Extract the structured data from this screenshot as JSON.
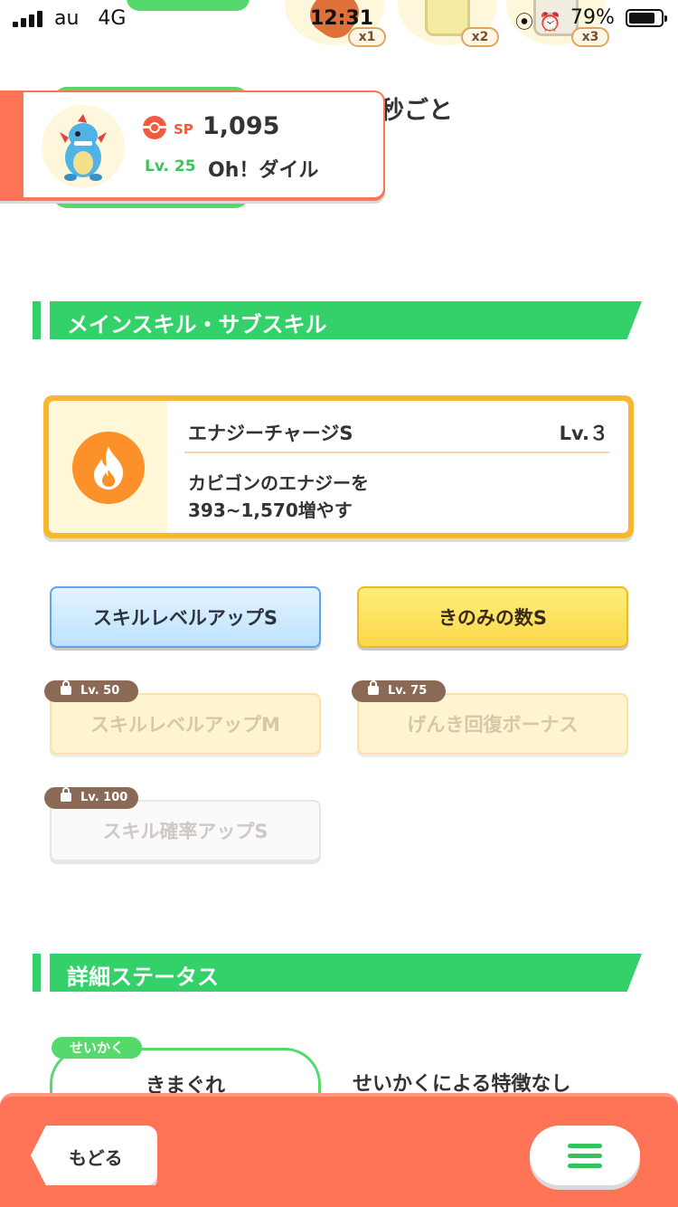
{
  "status_bar": {
    "carrier": "au",
    "network": "4G",
    "time": "12:31",
    "battery": "79%"
  },
  "top_items": [
    {
      "mult": "x1"
    },
    {
      "mult": "x2"
    },
    {
      "mult": "x3"
    }
  ],
  "background_fragment": "秒ごと",
  "pokemon": {
    "sp_label": "SP",
    "sp_value": "1,095",
    "level": "Lv. 25",
    "name": "Oh！ダイル"
  },
  "section_skills": {
    "title": "メインスキル・サブスキル"
  },
  "main_skill": {
    "name": "エナジーチャージS",
    "level": "Lv.３",
    "desc_line1": "カビゴンのエナジーを",
    "desc_line2": "393~1,570増やす",
    "icon": "flame-icon"
  },
  "sub_skills": [
    {
      "label": "スキルレベルアップS"
    },
    {
      "label": "きのみの数S"
    },
    {
      "label": "スキルレベルアップM",
      "lock": "Lv. 50"
    },
    {
      "label": "げんき回復ボーナス",
      "lock": "Lv. 75"
    },
    {
      "label": "スキル確率アップS",
      "lock": "Lv. 100"
    }
  ],
  "section_status": {
    "title": "詳細ステータス"
  },
  "nature": {
    "tag": "せいかく",
    "name": "きまぐれ",
    "desc": "せいかくによる特徴なし"
  },
  "bottom": {
    "back_label": "もどる",
    "menu_icon": "hamburger-icon"
  },
  "colors": {
    "accent_green": "#34d06a",
    "bottom_bar": "#ff7457",
    "skill_border": "#f7b733"
  }
}
